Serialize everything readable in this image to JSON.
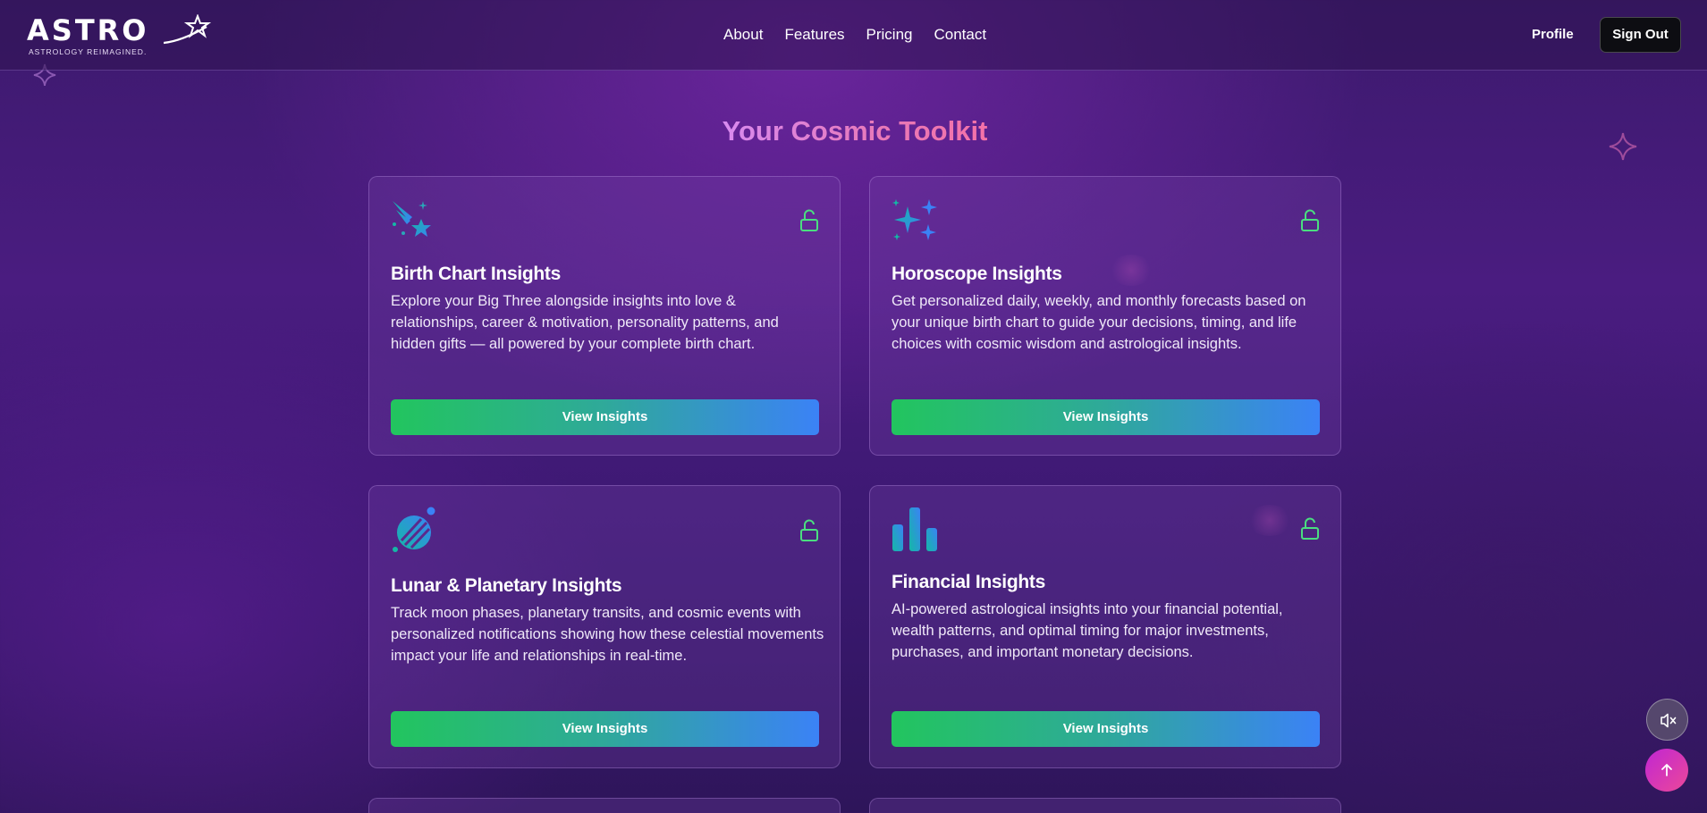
{
  "brand": {
    "name": "ASTRO",
    "tagline": "ASTROLOGY REIMAGINED."
  },
  "nav": {
    "links": [
      "About",
      "Features",
      "Pricing",
      "Contact"
    ],
    "profile_label": "Profile",
    "signout_label": "Sign Out"
  },
  "section": {
    "title": "Your Cosmic Toolkit"
  },
  "cards": [
    {
      "icon": "shooting-star-icon",
      "title": "Birth Chart Insights",
      "description": "Explore your Big Three alongside insights into love & relationships, career & motivation, personality patterns, and hidden gifts — all powered by your complete birth chart.",
      "button_label": "View Insights",
      "locked": false
    },
    {
      "icon": "sparkles-icon",
      "title": "Horoscope Insights",
      "description": "Get personalized daily, weekly, and monthly forecasts based on your unique birth chart to guide your decisions, timing, and life choices with cosmic wisdom and astrological insights.",
      "button_label": "View Insights",
      "locked": false
    },
    {
      "icon": "planet-icon",
      "title": "Lunar & Planetary Insights",
      "description": "Track moon phases, planetary transits, and cosmic events with personalized notifications showing how these celestial movements impact your life and relationships in real-time.",
      "button_label": "View Insights",
      "locked": false
    },
    {
      "icon": "bar-chart-icon",
      "title": "Financial Insights",
      "description": "AI-powered astrological insights into your financial potential, wealth patterns, and optimal timing for major investments, purchases, and important monetary decisions.",
      "button_label": "View Insights",
      "locked": false
    }
  ],
  "floating": {
    "mute_icon": "speaker-muted-icon",
    "top_icon": "arrow-up-icon"
  },
  "colors": {
    "accent_green": "#22c55e",
    "accent_blue": "#3b82f6",
    "icon_teal": "#2aa7b8",
    "lock_green": "#4ade80",
    "title_gradient_start": "#d88af0",
    "title_gradient_end": "#f472a8"
  }
}
